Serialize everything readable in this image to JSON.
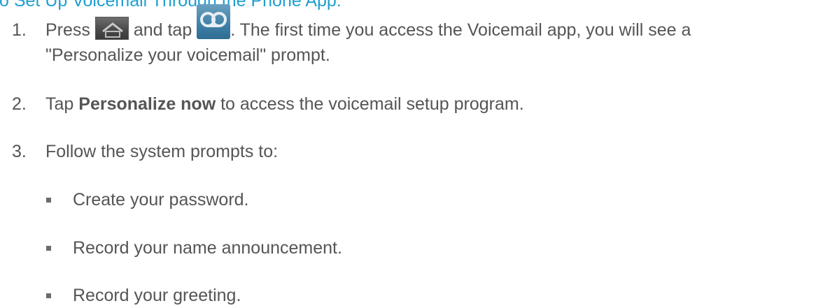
{
  "heading": "o Set Up Voicemail Through the Phone App:",
  "steps": [
    {
      "number": "1.",
      "part1": "Press",
      "part2": "and tap",
      "part3": ". The first time you access the Voicemail app, you will see a",
      "line2": "\"Personalize your voicemail\" prompt."
    },
    {
      "number": "2.",
      "pre": "Tap ",
      "bold": "Personalize now",
      "post": " to access the voicemail setup program."
    },
    {
      "number": "3.",
      "text": "Follow the system prompts to:"
    }
  ],
  "substeps": [
    "Create your password.",
    "Record your name announcement.",
    "Record your greeting."
  ],
  "icons": {
    "home": "home-icon",
    "voicemail": "voicemail-icon"
  }
}
